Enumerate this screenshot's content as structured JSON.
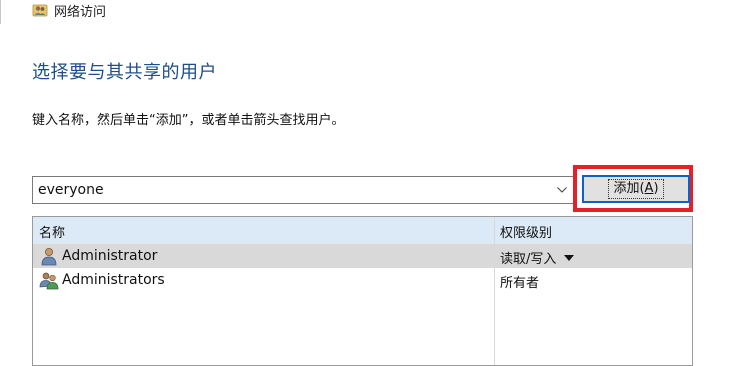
{
  "window": {
    "title": "网络访问",
    "icon": "share-users-icon"
  },
  "heading": "选择要与其共享的用户",
  "instruction": "键入名称，然后单击“添加”，或者单击箭头查找用户。",
  "name_input": {
    "value": "everyone",
    "dropdown_icon": "chevron-down-icon"
  },
  "add_button": {
    "label": "添加(",
    "accel": "A",
    "label_end": ")",
    "highlight_color": "#e0222b"
  },
  "table": {
    "columns": [
      "名称",
      "权限级别"
    ],
    "rows": [
      {
        "name": "Administrator",
        "permission": "读取/写入",
        "icon": "user-icon",
        "selected": true,
        "has_menu": true
      },
      {
        "name": "Administrators",
        "permission": "所有者",
        "icon": "users-group-icon",
        "selected": false,
        "has_menu": false
      }
    ]
  }
}
